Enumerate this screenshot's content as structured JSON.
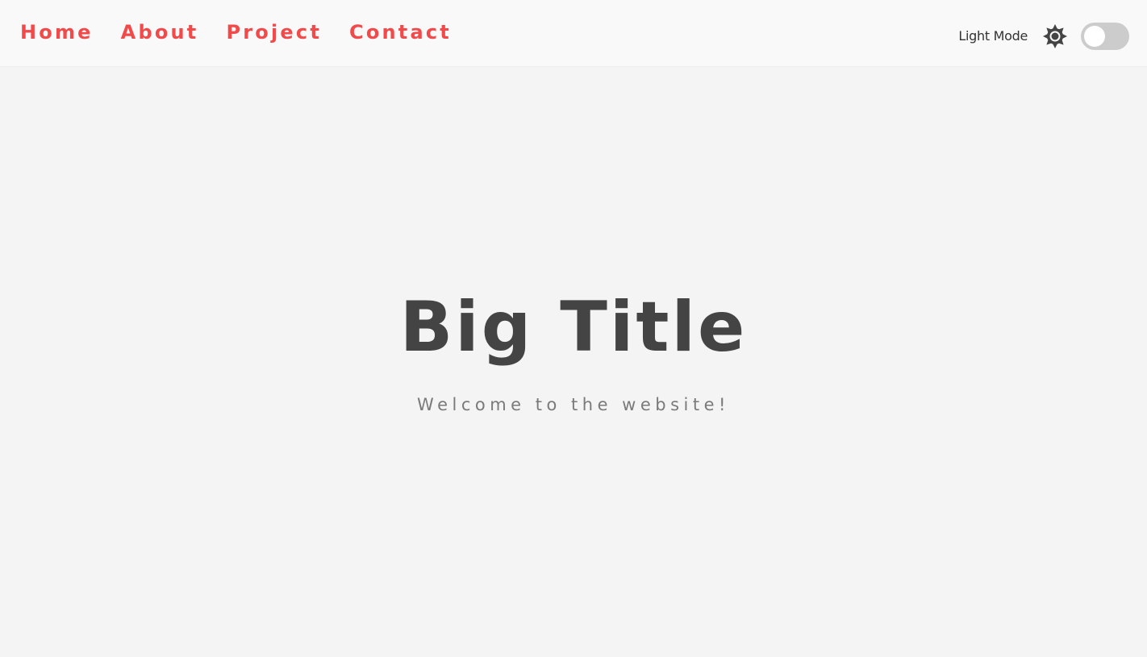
{
  "nav": {
    "links": [
      {
        "label": "Home"
      },
      {
        "label": "About"
      },
      {
        "label": "Project"
      },
      {
        "label": "Contact"
      }
    ]
  },
  "theme": {
    "label": "Light Mode",
    "icon": "sun-icon",
    "toggle_on": false
  },
  "hero": {
    "title": "Big Title",
    "subtitle": "Welcome to the website!"
  },
  "colors": {
    "accent": "#f24a4a",
    "title_text": "#444444",
    "subtitle_text": "#7a7a7a",
    "background": "#f4f4f4",
    "navbar_background": "#f9f9f9",
    "toggle_track": "#cccccc"
  }
}
